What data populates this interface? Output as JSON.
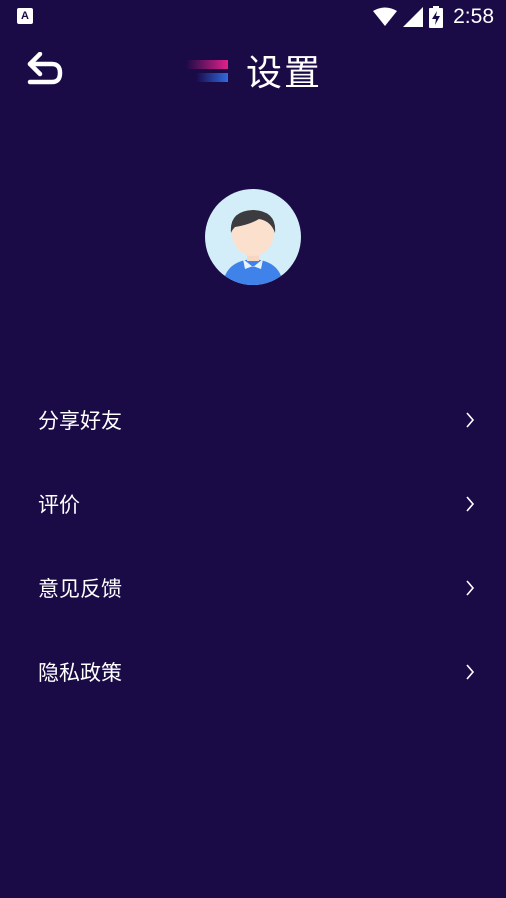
{
  "status_bar": {
    "app_icon": "A",
    "time": "2:58",
    "icons": [
      "wifi-icon",
      "signal-icon",
      "battery-charging-icon"
    ]
  },
  "header": {
    "back_icon": "back-arrow-icon",
    "title": "设置"
  },
  "profile": {
    "avatar_icon": "user-avatar-icon"
  },
  "menu": {
    "items": [
      {
        "label": "分享好友",
        "icon": "chevron-right-icon"
      },
      {
        "label": "评价",
        "icon": "chevron-right-icon"
      },
      {
        "label": "意见反馈",
        "icon": "chevron-right-icon"
      },
      {
        "label": "隐私政策",
        "icon": "chevron-right-icon"
      }
    ]
  },
  "colors": {
    "background": "#1a0b47",
    "text": "#ffffff",
    "accent_pink": "#e0218a",
    "accent_blue": "#2f6be0",
    "avatar_bg": "#d3eef8"
  }
}
